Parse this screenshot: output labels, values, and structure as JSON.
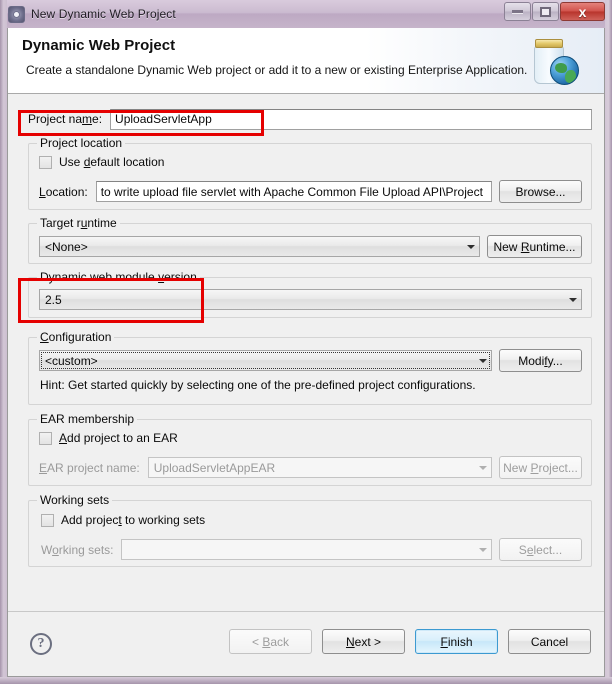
{
  "window": {
    "title": "New Dynamic Web Project",
    "icon": "gear-icon",
    "buttons": {
      "minimize": "–",
      "maximize": "□",
      "close": "x"
    }
  },
  "banner": {
    "title": "Dynamic Web Project",
    "subtitle": "Create a standalone Dynamic Web project or add it to a new or existing Enterprise Application.",
    "icon": "jar-globe-icon"
  },
  "form": {
    "project_name": {
      "label": "Project name:",
      "value": "UploadServletApp"
    },
    "project_location": {
      "legend": "Project location",
      "use_default_label": "Use default location",
      "use_default_checked": false,
      "location_label": "Location:",
      "location_value": "to write upload file servlet with Apache Common File Upload API\\Project",
      "browse_label": "Browse..."
    },
    "target_runtime": {
      "legend": "Target runtime",
      "value": "<None>",
      "new_runtime_label": "New Runtime..."
    },
    "dynamic_web_module_version": {
      "legend": "Dynamic web module version",
      "value": "2.5"
    },
    "configuration": {
      "legend": "Configuration",
      "value": "<custom>",
      "modify_label": "Modify...",
      "hint": "Hint: Get started quickly by selecting one of the pre-defined project configurations."
    },
    "ear_membership": {
      "legend": "EAR membership",
      "add_to_ear_label": "Add project to an EAR",
      "add_to_ear_checked": false,
      "ear_project_name_label": "EAR project name:",
      "ear_project_name_value": "UploadServletAppEAR",
      "new_project_label": "New Project..."
    },
    "working_sets": {
      "legend": "Working sets",
      "add_to_working_sets_label": "Add project to working sets",
      "add_to_working_sets_checked": false,
      "working_sets_label": "Working sets:",
      "working_sets_value": "",
      "select_label": "Select..."
    }
  },
  "footer": {
    "help_label": "?",
    "back_label": "< Back",
    "next_label": "Next >",
    "finish_label": "Finish",
    "cancel_label": "Cancel"
  },
  "annotations": {
    "highlight_color": "#e50000",
    "boxes": [
      {
        "target": "project-name-row"
      },
      {
        "target": "dynamic-web-module-version-group"
      }
    ]
  }
}
